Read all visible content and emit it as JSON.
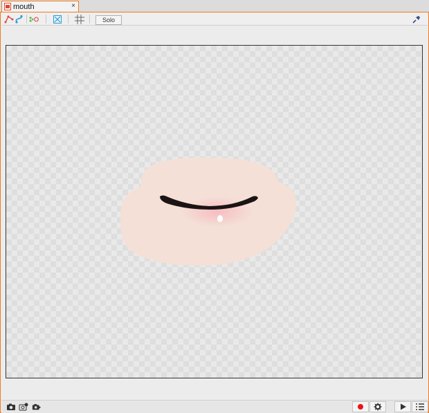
{
  "tab": {
    "title": "mouth",
    "close_glyph": "×"
  },
  "toolbar": {
    "solo_label": "Solo",
    "icons": [
      "deform-path-icon",
      "link-icon",
      "glue-icon",
      "fit-view-icon",
      "grid-icon",
      "pin-icon"
    ]
  },
  "canvas": {
    "subject": "mouth-artwork"
  },
  "bottombar": {
    "icons": [
      "camera-icon",
      "camera-add-icon",
      "camera-settings-icon",
      "record-icon",
      "gear-icon",
      "play-icon",
      "list-icon"
    ]
  },
  "colors": {
    "accent": "#f07c20",
    "record": "#e8141b",
    "skin": "#f4e0d6",
    "lip_dark": "#1a1414",
    "lip_red": "#b85a64"
  }
}
